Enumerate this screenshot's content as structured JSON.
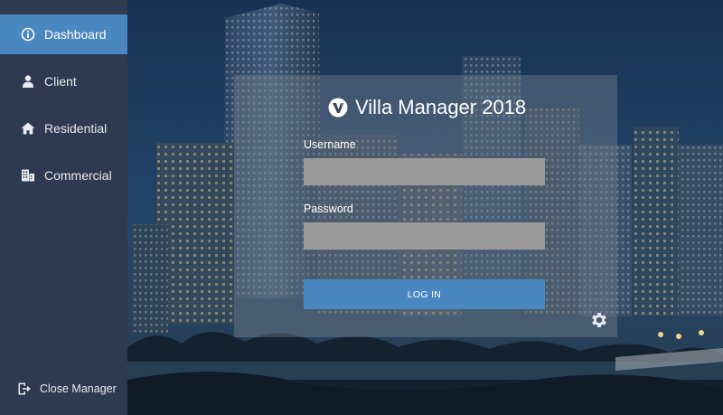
{
  "sidebar": {
    "items": [
      {
        "label": "Dashboard",
        "icon": "info-icon",
        "active": true
      },
      {
        "label": "Client",
        "icon": "user-icon",
        "active": false
      },
      {
        "label": "Residential",
        "icon": "home-icon",
        "active": false
      },
      {
        "label": "Commercial",
        "icon": "building-icon",
        "active": false
      }
    ],
    "close_label": "Close Manager",
    "close_icon": "exit-icon"
  },
  "login": {
    "title": "Villa Manager 2018",
    "logo_icon": "v-logo-icon",
    "username_label": "Username",
    "username_value": "",
    "password_label": "Password",
    "password_value": "",
    "button_label": "LOG IN",
    "settings_icon": "gear-icon"
  },
  "colors": {
    "sidebar_bg": "#2d3a4f",
    "accent": "#4a86bf",
    "field_bg": "#9b9b9b"
  }
}
